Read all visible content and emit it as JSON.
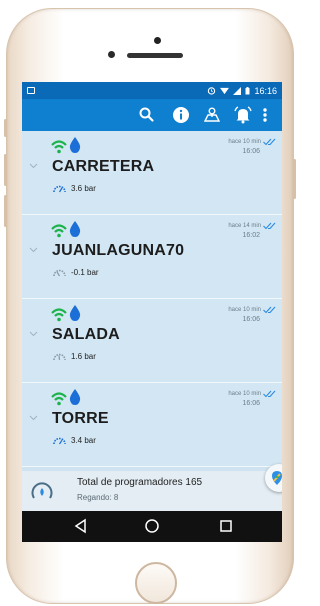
{
  "status_bar": {
    "time": "16:16"
  },
  "programmers": [
    {
      "name": "CARRETERA",
      "ago": "hace 10 min",
      "time": "16:06",
      "pressure": "3.6 bar"
    },
    {
      "name": "JUANLAGUNA70",
      "ago": "hace 14 min",
      "time": "16:02",
      "pressure": "-0.1 bar"
    },
    {
      "name": "SALADA",
      "ago": "hace 10 min",
      "time": "16:06",
      "pressure": "1.6 bar"
    },
    {
      "name": "TORRE",
      "ago": "hace 10 min",
      "time": "16:06",
      "pressure": "3.4 bar"
    }
  ],
  "footer": {
    "total": "Total de programadores 165",
    "watering": "Regando: 8"
  },
  "colors": {
    "toolbar": "#0f7fd0",
    "status_bar": "#0a6ab8",
    "card": "#d2e6f3",
    "accent_green": "#1bb34a",
    "accent_blue": "#1b6fd6"
  }
}
